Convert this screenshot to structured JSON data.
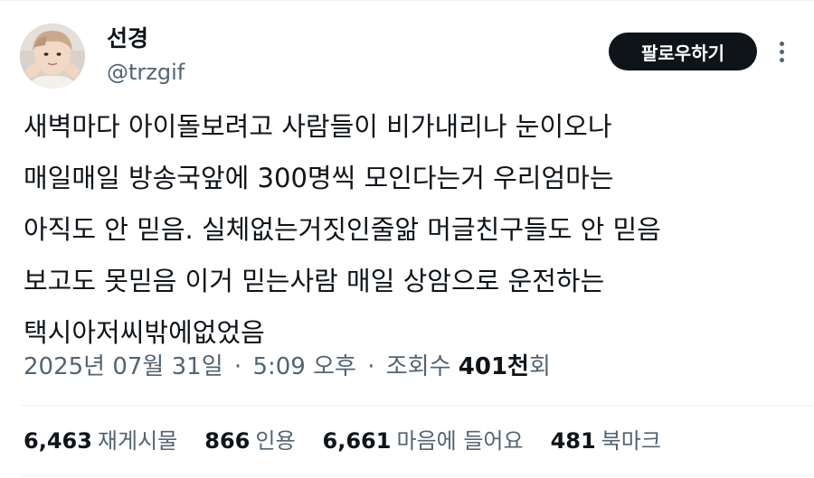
{
  "author": {
    "display_name": "선경",
    "handle": "@trzgif"
  },
  "actions": {
    "follow_label": "팔로우하기",
    "more_icon": "more-dots-vertical"
  },
  "post": {
    "lines": [
      "새벽마다 아이돌보려고 사람들이 비가내리나 눈이오나",
      "매일매일 방송국앞에 300명씩 모인다는거 우리엄마는",
      "아직도 안 믿음. 실체없는거짓인줄앎 머글친구들도 안 믿음",
      "보고도 못믿음  이거 믿는사람 매일 상암으로 운전하는",
      "택시아저씨밖에없었음"
    ]
  },
  "meta": {
    "date": "2025년 07월 31일",
    "time": "5:09 오후",
    "separator": "·",
    "views_label": "조회수",
    "views_value": "401천",
    "views_suffix": "회"
  },
  "stats": [
    {
      "value": "6,463",
      "label": "재게시물"
    },
    {
      "value": "866",
      "label": "인용"
    },
    {
      "value": "6,661",
      "label": "마음에 들어요"
    },
    {
      "value": "481",
      "label": "북마크"
    }
  ],
  "colors": {
    "text_primary": "#0f1419",
    "text_secondary": "#536471",
    "button_bg": "#0f1419",
    "divider": "#eff3f4"
  }
}
